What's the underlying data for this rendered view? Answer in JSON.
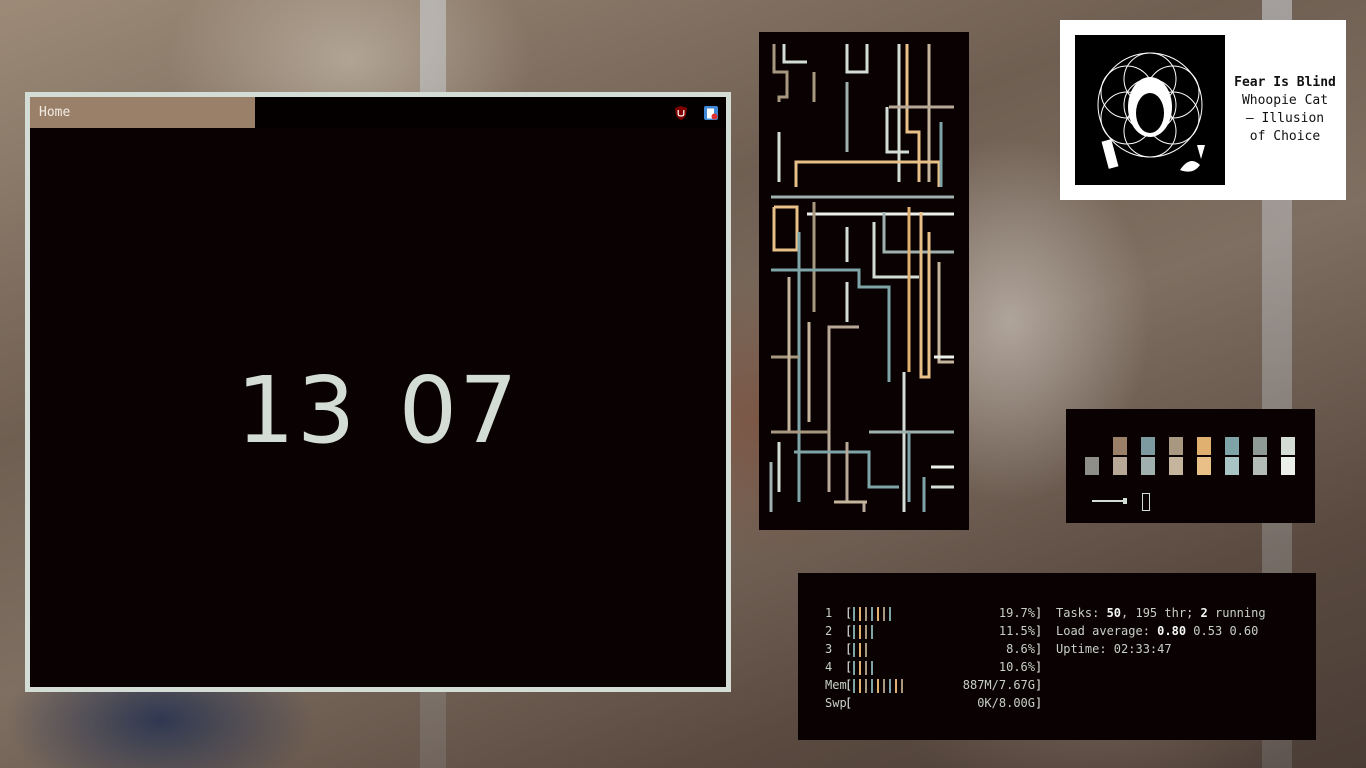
{
  "browser": {
    "tab_label": "Home",
    "clock": "13 07",
    "extensions": [
      "ublock-origin-icon",
      "privacy-badger-icon"
    ]
  },
  "now_playing": {
    "title": "Fear Is Blind",
    "artist_album": "Whoopie Cat – Illusion of Choice",
    "line1": "Whoopie Cat",
    "line2": "– Illusion",
    "line3": "of Choice"
  },
  "palette": {
    "colors": [
      {
        "top": "#8f8f8a",
        "bottom": "#8f8f8a",
        "full": false
      },
      {
        "top": "#9a8068",
        "bottom": "#b8a898"
      },
      {
        "top": "#7d9aa0",
        "bottom": "#9fb0ae"
      },
      {
        "top": "#a89880",
        "bottom": "#c4b59c"
      },
      {
        "top": "#e0b070",
        "bottom": "#e8c088"
      },
      {
        "top": "#7fa4a8",
        "bottom": "#a8c4c4"
      },
      {
        "top": "#8f9a96",
        "bottom": "#b4bcb8"
      },
      {
        "top": "#d3ddd6",
        "bottom": "#ecf0ea"
      }
    ]
  },
  "htop": {
    "meters": [
      {
        "label": "1",
        "value": "19.7%",
        "bars": 7
      },
      {
        "label": "2",
        "value": "11.5%",
        "bars": 4
      },
      {
        "label": "3",
        "value": "8.6%",
        "bars": 3
      },
      {
        "label": "4",
        "value": "10.6%",
        "bars": 4
      },
      {
        "label": "Mem",
        "value": "887M/7.67G",
        "bars": 9
      },
      {
        "label": "Swp",
        "value": "0K/8.00G",
        "bars": 0
      }
    ],
    "tasks_prefix": "Tasks: ",
    "tasks_count": "50",
    "tasks_mid": ", ",
    "tasks_threads": "195",
    "tasks_thr": " thr; ",
    "tasks_running": "2",
    "tasks_suffix": " running",
    "load_prefix": "Load average: ",
    "load_1": "0.80",
    "load_5": "0.53",
    "load_15": "0.60",
    "uptime_prefix": "Uptime: ",
    "uptime": "02:33:47"
  },
  "colors": {
    "accent": "#9a8068",
    "foreground": "#d3ddd6",
    "background": "#0a0202",
    "bar_cyan": "#7fa4a8",
    "bar_orange": "#e0b070",
    "bar_tan": "#a89880"
  }
}
